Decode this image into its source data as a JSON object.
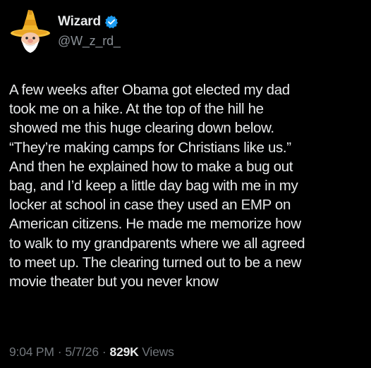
{
  "author": {
    "display_name": "Wizard",
    "handle": "@W_z_rd_",
    "avatar_icon": "wizard-avatar-icon",
    "verified_icon": "verified-badge-icon",
    "verified_color": "#1d9bf0"
  },
  "post": {
    "lines": [
      "A few weeks after Obama got elected my dad",
      "took me on a hike. At the top of the hill he",
      "showed me this huge clearing down below.",
      "“They’re making camps for Christians like us.”",
      "And then he explained how to make a bug out",
      "bag, and I’d keep a little day bag with me in my",
      "locker at school in case they used an EMP on",
      "American citizens. He made me memorize how",
      "to walk to my grandparents where we all agreed",
      "to meet up. The clearing turned out to be a new",
      "movie theater but you never know"
    ]
  },
  "meta": {
    "time": "9:04 PM",
    "separator": "·",
    "date": "5/7/26",
    "views_count": "829K",
    "views_label": "Views"
  },
  "colors": {
    "background": "#000000",
    "primary_text": "#e7e9ea",
    "secondary_text": "#71767b"
  }
}
